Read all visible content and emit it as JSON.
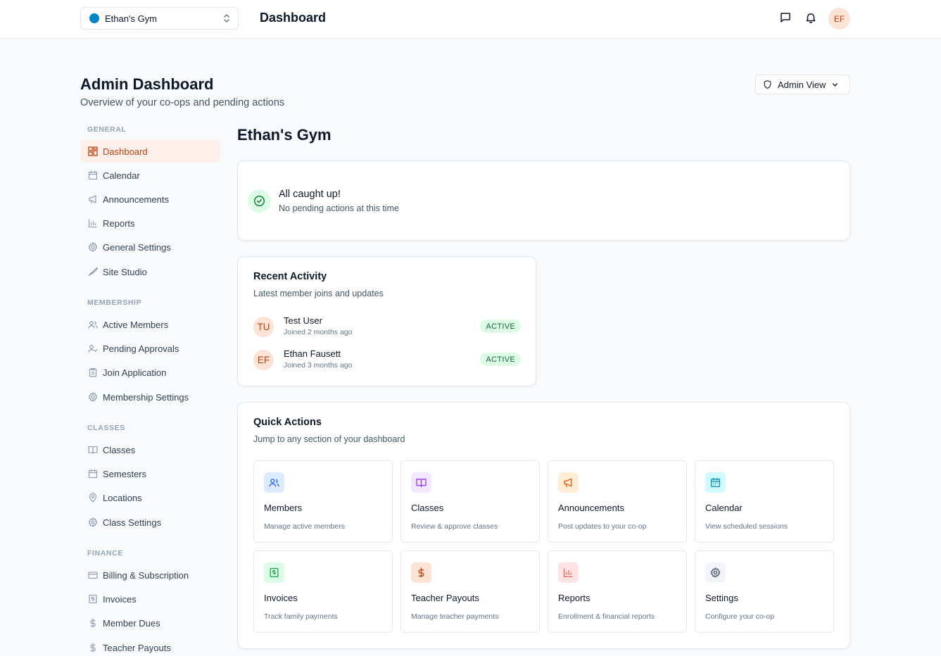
{
  "topbar": {
    "org_name": "Ethan's Gym",
    "org_color": "#0284c7",
    "title": "Dashboard",
    "icons": [
      "message-icon",
      "bell-icon"
    ],
    "user_initials": "EF"
  },
  "header": {
    "title": "Admin Dashboard",
    "subtitle": "Overview of your co-ops and pending actions",
    "view_button": "Admin View"
  },
  "sidebar": {
    "sections": [
      {
        "title": "GENERAL",
        "items": [
          {
            "label": "Dashboard",
            "icon": "dashboard-icon",
            "active": true
          },
          {
            "label": "Calendar",
            "icon": "calendar-icon"
          },
          {
            "label": "Announcements",
            "icon": "megaphone-icon"
          },
          {
            "label": "Reports",
            "icon": "chart-icon"
          },
          {
            "label": "General Settings",
            "icon": "gear-icon"
          },
          {
            "label": "Site Studio",
            "icon": "brush-icon"
          }
        ]
      },
      {
        "title": "MEMBERSHIP",
        "items": [
          {
            "label": "Active Members",
            "icon": "users-icon"
          },
          {
            "label": "Pending Approvals",
            "icon": "user-check-icon"
          },
          {
            "label": "Join Application",
            "icon": "clipboard-icon"
          },
          {
            "label": "Membership Settings",
            "icon": "gear-icon"
          }
        ]
      },
      {
        "title": "CLASSES",
        "items": [
          {
            "label": "Classes",
            "icon": "book-icon"
          },
          {
            "label": "Semesters",
            "icon": "calendar-icon"
          },
          {
            "label": "Locations",
            "icon": "map-pin-icon"
          },
          {
            "label": "Class Settings",
            "icon": "gear-icon"
          }
        ]
      },
      {
        "title": "FINANCE",
        "items": [
          {
            "label": "Billing & Subscription",
            "icon": "credit-card-icon"
          },
          {
            "label": "Invoices",
            "icon": "invoice-icon"
          },
          {
            "label": "Member Dues",
            "icon": "dollar-icon"
          },
          {
            "label": "Teacher Payouts",
            "icon": "dollar-icon"
          }
        ]
      }
    ]
  },
  "main": {
    "org_title": "Ethan's Gym",
    "caught_up": {
      "title": "All caught up!",
      "subtitle": "No pending actions at this time"
    },
    "recent_activity": {
      "title": "Recent Activity",
      "subtitle": "Latest member joins and updates",
      "items": [
        {
          "initials": "TU",
          "name": "Test User",
          "sub": "Joined 2 months ago",
          "status": "ACTIVE"
        },
        {
          "initials": "EF",
          "name": "Ethan Fausett",
          "sub": "Joined 3 months ago",
          "status": "ACTIVE"
        }
      ]
    },
    "quick_actions": {
      "title": "Quick Actions",
      "subtitle": "Jump to any section of your dashboard",
      "items": [
        {
          "title": "Members",
          "desc": "Manage active members",
          "icon": "users-icon",
          "bg": "#dbeafe",
          "fg": "#2563eb"
        },
        {
          "title": "Classes",
          "desc": "Review & approve classes",
          "icon": "book-icon",
          "bg": "#f3e8ff",
          "fg": "#9333ea"
        },
        {
          "title": "Announcements",
          "desc": "Post updates to your co-op",
          "icon": "megaphone-icon",
          "bg": "#ffedd5",
          "fg": "#ea580c"
        },
        {
          "title": "Calendar",
          "desc": "View scheduled sessions",
          "icon": "calendar-icon",
          "bg": "#cffafe",
          "fg": "#0891b2"
        },
        {
          "title": "Invoices",
          "desc": "Track family payments",
          "icon": "invoice-icon",
          "bg": "#dcfce7",
          "fg": "#16a34a"
        },
        {
          "title": "Teacher Payouts",
          "desc": "Manage teacher payments",
          "icon": "dollar-icon",
          "bg": "#fde3d6",
          "fg": "#c2410c"
        },
        {
          "title": "Reports",
          "desc": "Enrollment & financial reports",
          "icon": "chart-icon",
          "bg": "#fde3e3",
          "fg": "#dc6b5b"
        },
        {
          "title": "Settings",
          "desc": "Configure your co-op",
          "icon": "gear-icon",
          "bg": "#f1f5f9",
          "fg": "#475569"
        }
      ]
    }
  }
}
